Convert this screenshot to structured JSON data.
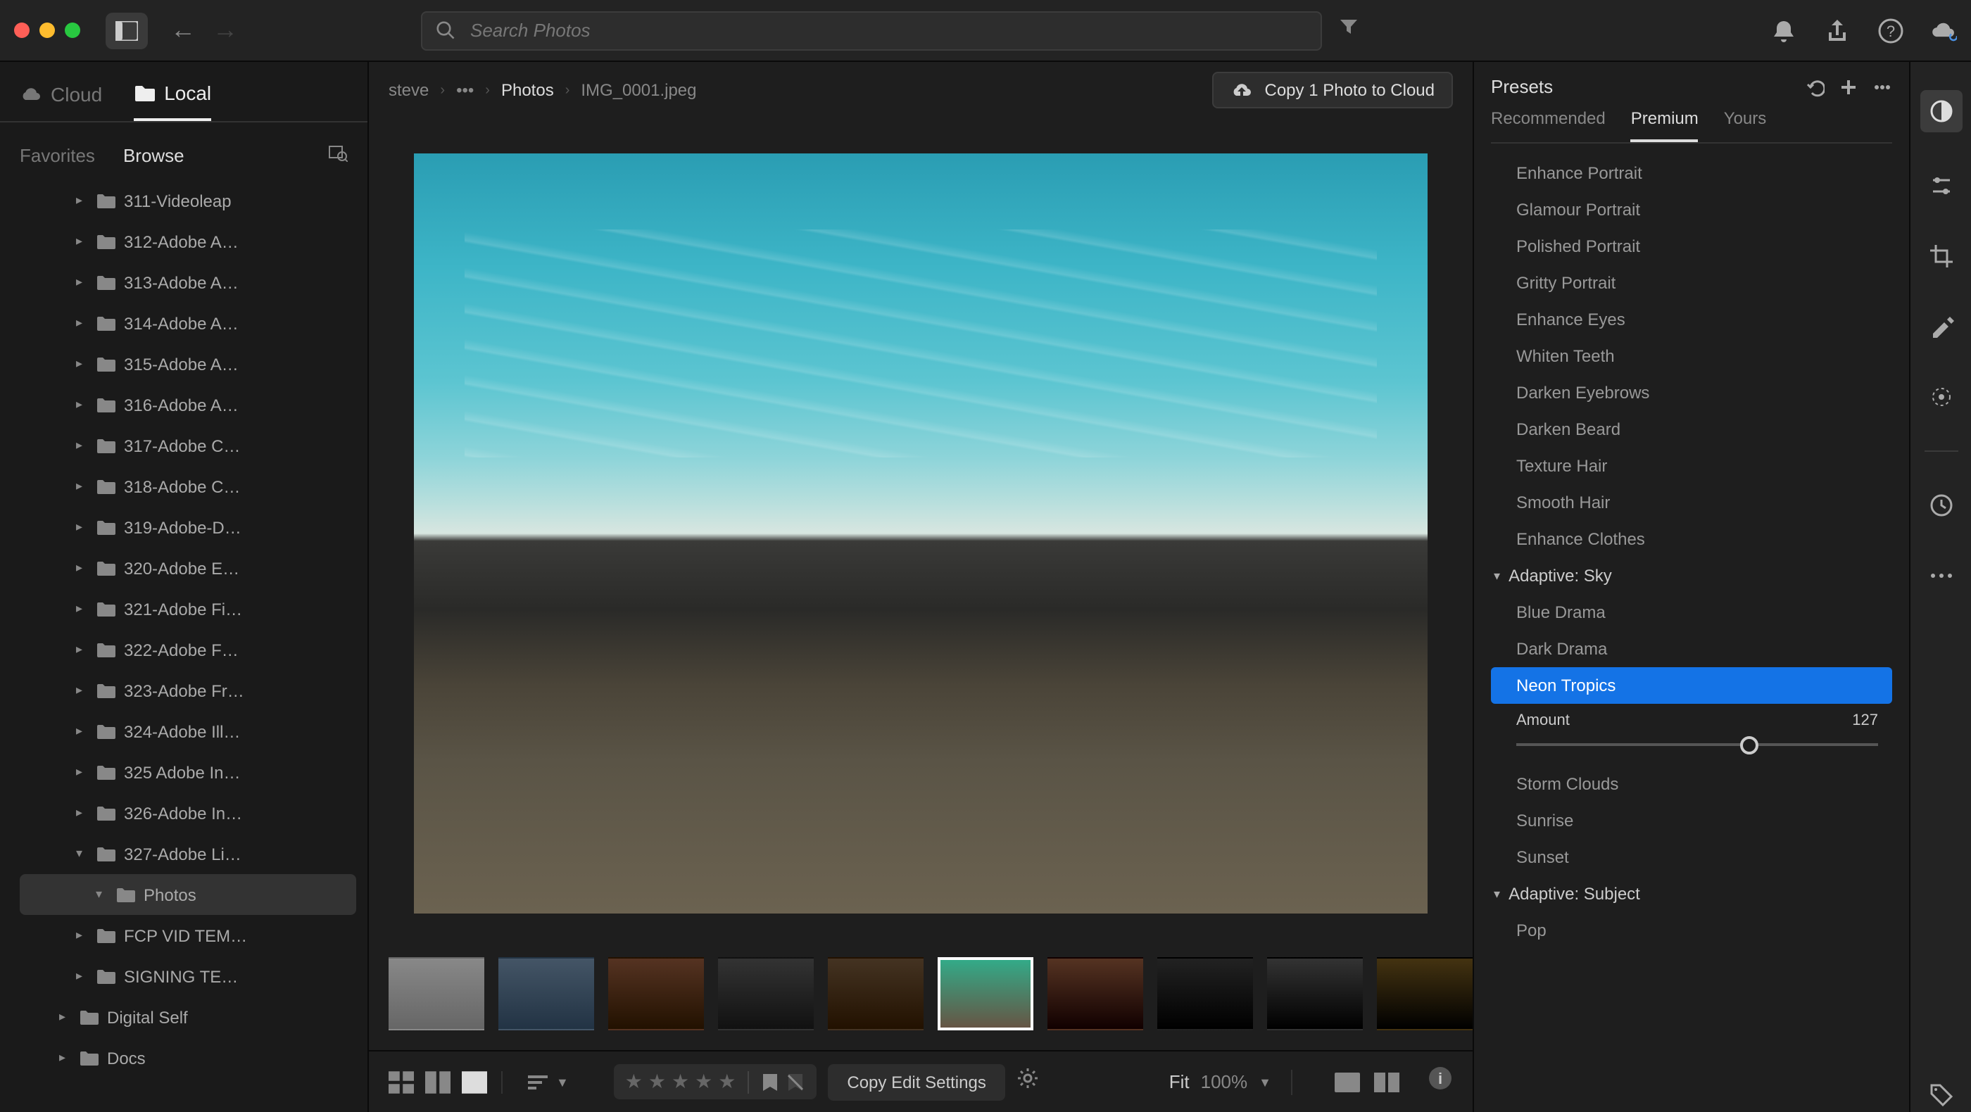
{
  "window": {
    "close": "#ff5f57",
    "min": "#febc2e",
    "max": "#28c840"
  },
  "search": {
    "placeholder": "Search Photos"
  },
  "source_tabs": {
    "cloud": "Cloud",
    "local": "Local"
  },
  "browse_tabs": {
    "favorites": "Favorites",
    "browse": "Browse"
  },
  "folders": [
    {
      "label": "311-Videoleap",
      "depth": 2
    },
    {
      "label": "312-Adobe A…",
      "depth": 2
    },
    {
      "label": "313-Adobe A…",
      "depth": 2
    },
    {
      "label": "314-Adobe A…",
      "depth": 2
    },
    {
      "label": "315-Adobe A…",
      "depth": 2
    },
    {
      "label": "316-Adobe A…",
      "depth": 2
    },
    {
      "label": "317-Adobe C…",
      "depth": 2
    },
    {
      "label": "318-Adobe C…",
      "depth": 2
    },
    {
      "label": "319-Adobe-D…",
      "depth": 2
    },
    {
      "label": "320-Adobe E…",
      "depth": 2
    },
    {
      "label": "321-Adobe Fi…",
      "depth": 2
    },
    {
      "label": "322-Adobe F…",
      "depth": 2
    },
    {
      "label": "323-Adobe Fr…",
      "depth": 2
    },
    {
      "label": "324-Adobe Ill…",
      "depth": 2
    },
    {
      "label": "325 Adobe In…",
      "depth": 2
    },
    {
      "label": "326-Adobe In…",
      "depth": 2
    },
    {
      "label": "327-Adobe Li…",
      "depth": 2,
      "expanded": true
    },
    {
      "label": "Photos",
      "depth": 3,
      "selected": true
    },
    {
      "label": "FCP VID TEM…",
      "depth": 2
    },
    {
      "label": "SIGNING TE…",
      "depth": 2
    },
    {
      "label": "Digital Self",
      "depth": 1
    },
    {
      "label": "Docs",
      "depth": 1
    }
  ],
  "breadcrumb": {
    "c1": "steve",
    "c2": "•••",
    "c3": "Photos",
    "c4": "IMG_0001.jpeg"
  },
  "copy_cloud": "Copy 1 Photo to Cloud",
  "copy_edit": "Copy Edit Settings",
  "zoom": {
    "fit": "Fit",
    "pct": "100%"
  },
  "presets_panel": {
    "title": "Presets",
    "tabs": {
      "rec": "Recommended",
      "premium": "Premium",
      "yours": "Yours"
    },
    "portrait_items": [
      "Enhance Portrait",
      "Glamour Portrait",
      "Polished Portrait",
      "Gritty Portrait",
      "Enhance Eyes",
      "Whiten Teeth",
      "Darken Eyebrows",
      "Darken Beard",
      "Texture Hair",
      "Smooth Hair",
      "Enhance Clothes"
    ],
    "group_sky": "Adaptive: Sky",
    "sky_items": [
      "Blue Drama",
      "Dark Drama",
      "Neon Tropics"
    ],
    "amount_label": "Amount",
    "amount_value": "127",
    "sky_items2": [
      "Storm Clouds",
      "Sunrise",
      "Sunset"
    ],
    "group_subject": "Adaptive: Subject",
    "subject_items": [
      "Pop"
    ]
  }
}
